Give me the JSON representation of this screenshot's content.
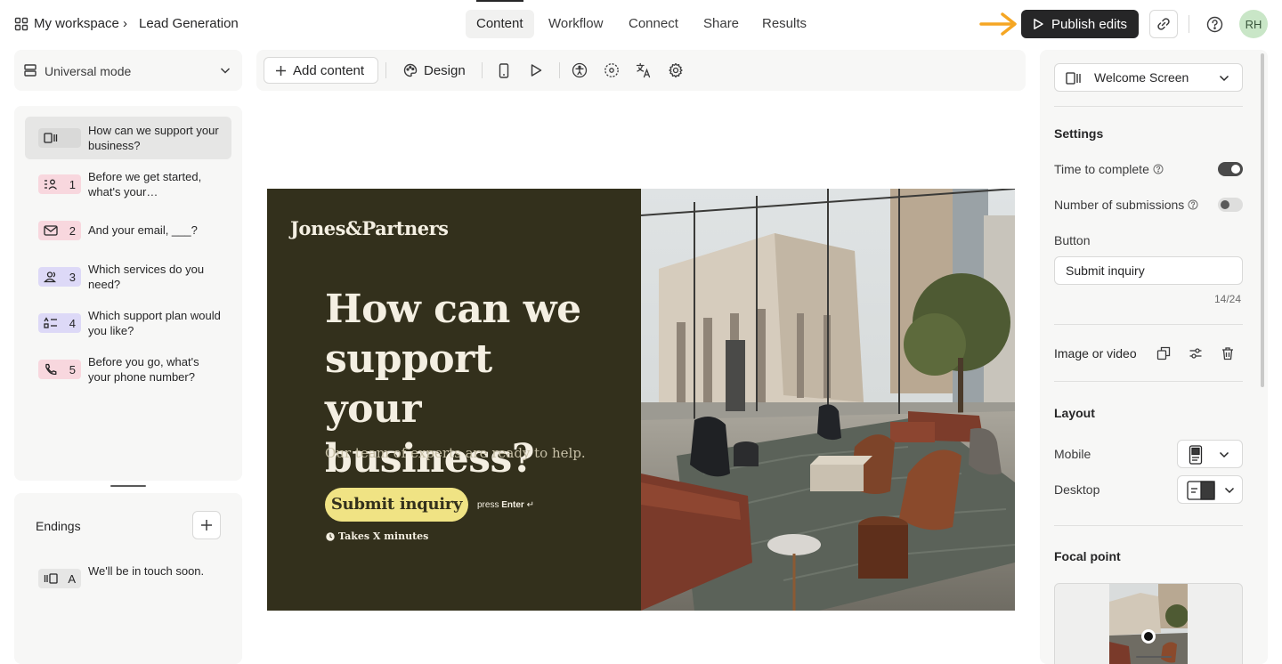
{
  "header": {
    "workspace": "My workspace",
    "separator": "›",
    "form_name": "Lead Generation",
    "tabs": [
      {
        "label": "Content",
        "active": true
      },
      {
        "label": "Workflow",
        "active": false
      },
      {
        "label": "Connect",
        "active": false
      },
      {
        "label": "Share",
        "active": false
      },
      {
        "label": "Results",
        "active": false
      }
    ],
    "publish_label": "Publish edits",
    "avatar_initials": "RH",
    "arrow_color": "#f5a623"
  },
  "left": {
    "mode_label": "Universal mode",
    "questions": [
      {
        "num": "",
        "text": "How can we support your business?",
        "icon": "welcome-screen-icon",
        "color": "#e6e6e5",
        "active": true
      },
      {
        "num": "1",
        "text": "Before we get started, what's your…",
        "icon": "contact-info-icon",
        "color": "#f8d7de"
      },
      {
        "num": "2",
        "text": "And your email, ___?",
        "icon": "email-icon",
        "color": "#f8d7de"
      },
      {
        "num": "3",
        "text": "Which services do you need?",
        "icon": "multiple-choice-icon",
        "color": "#ddd9f7"
      },
      {
        "num": "4",
        "text": "Which support plan would you like?",
        "icon": "ranking-icon",
        "color": "#ddd9f7"
      },
      {
        "num": "5",
        "text": "Before you go, what's your phone number?",
        "icon": "phone-icon",
        "color": "#f8d7de"
      }
    ],
    "endings_title": "Endings",
    "endings": [
      {
        "num": "A",
        "text": "We'll be in touch soon.",
        "icon": "ending-screen-icon",
        "color": "#e6e6e5"
      }
    ]
  },
  "toolbar": {
    "add_content_label": "Add content",
    "design_label": "Design"
  },
  "canvas": {
    "logo": "Jones&Partners",
    "headline": "How can we support your business?",
    "subtext": "Our team of experts are ready to help.",
    "button_label": "Submit inquiry",
    "press_label": "press",
    "enter_label": "Enter",
    "enter_glyph": "↵",
    "time_note": "Takes X minutes",
    "bg_color": "#33301c",
    "button_color": "#f0e384"
  },
  "right": {
    "screen_select": "Welcome Screen",
    "settings_title": "Settings",
    "time_to_complete_label": "Time to complete",
    "time_to_complete_on": true,
    "submissions_label": "Number of submissions",
    "submissions_on": false,
    "button_label": "Button",
    "button_value": "Submit inquiry",
    "char_count": "14/24",
    "image_video_label": "Image or video",
    "layout_title": "Layout",
    "mobile_label": "Mobile",
    "desktop_label": "Desktop",
    "focal_point_title": "Focal point"
  }
}
